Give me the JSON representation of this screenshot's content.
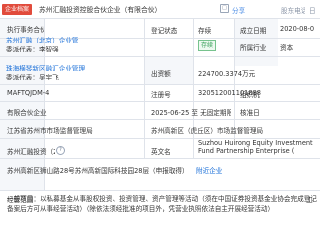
{
  "topbar": {
    "badge": "企业档案",
    "company_name": "苏州汇融投资控股合伙企业（有限合伙）",
    "share_label": "分享",
    "phone_label": "股东电话",
    "right_cut": "日"
  },
  "rows": {
    "partner_label": "执行事务合伙人",
    "partner_value": "苏州汇融（北京）企业管理有限公司",
    "partner_sub": "委派代表：李智强",
    "partner_value_2": "珠海横琴新区融汇企业管理咨询有限公司",
    "partner_sub_2": "委派代表：吴宇飞",
    "status_label": "登记状态",
    "status_value": "存续",
    "date_label": "成立日期",
    "date_value": "2020-08-0",
    "capital_label": "出资额",
    "capital_value": "224700.3374万元",
    "industry_label": "所属行业",
    "industry_value": "资本",
    "code_label": "MAFTQJDM-4",
    "code2_label": "注册号",
    "code2_value": "320512001101888",
    "org_label": "组织机",
    "type_label": "有限合伙企业",
    "period_label": "营业期限",
    "period_value": "2025-06-25 至 无固定期限",
    "approve_label": "核准日",
    "authority_label": "江苏省苏州市市场监督管理局",
    "reg_auth_label": "登记机关",
    "reg_auth_value": "苏州高新区（虎丘区）市场监督管理局",
    "former_label": "曾用名",
    "former_value": "苏州汇融投资（2）",
    "english_label": "英文名",
    "english_value": "Suzhou Huirong Equity Investment Fund Partnership Enterprise (",
    "address_label": "注册地址",
    "address_value": "苏州高新区狮山路28号苏州高新国际科技园28层（申报取得）",
    "address_link": "附近企业",
    "scope_label": "经营范围",
    "scope_value": "一般项目：以私募基金从事股权投资、投资管理、资产管理等活动（须在中国证券投资基金业协会完成登记备案后方可从事经营活动）（除依法须经批准的项目外，凭营业执照依法自主开展经营活动）",
    "scope_cut": "工"
  }
}
